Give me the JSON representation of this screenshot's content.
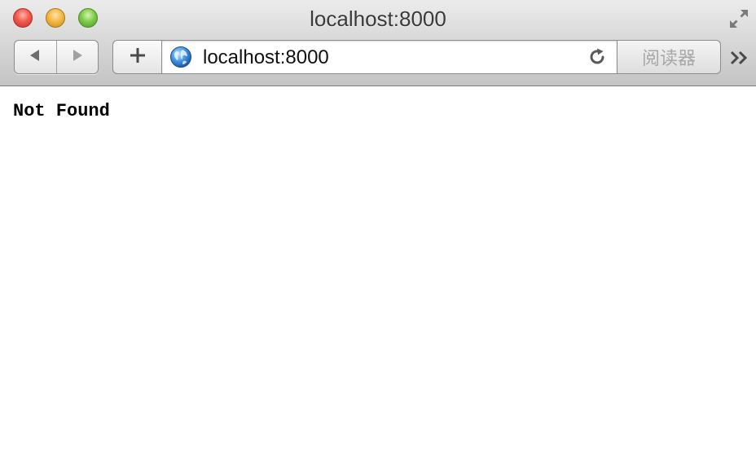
{
  "window": {
    "title": "localhost:8000"
  },
  "toolbar": {
    "back_icon": "back-arrow-icon",
    "forward_icon": "forward-arrow-icon",
    "add_icon": "plus-icon",
    "address": {
      "value": "localhost:8000",
      "site_icon": "globe-icon",
      "reload_icon": "reload-icon"
    },
    "reader_label": "阅读器",
    "overflow_icon": "chevron-double-right-icon"
  },
  "page": {
    "text": "Not Found"
  },
  "colors": {
    "close": "#f25a4d",
    "minimize": "#f5b942",
    "zoom": "#7fcc4a"
  }
}
